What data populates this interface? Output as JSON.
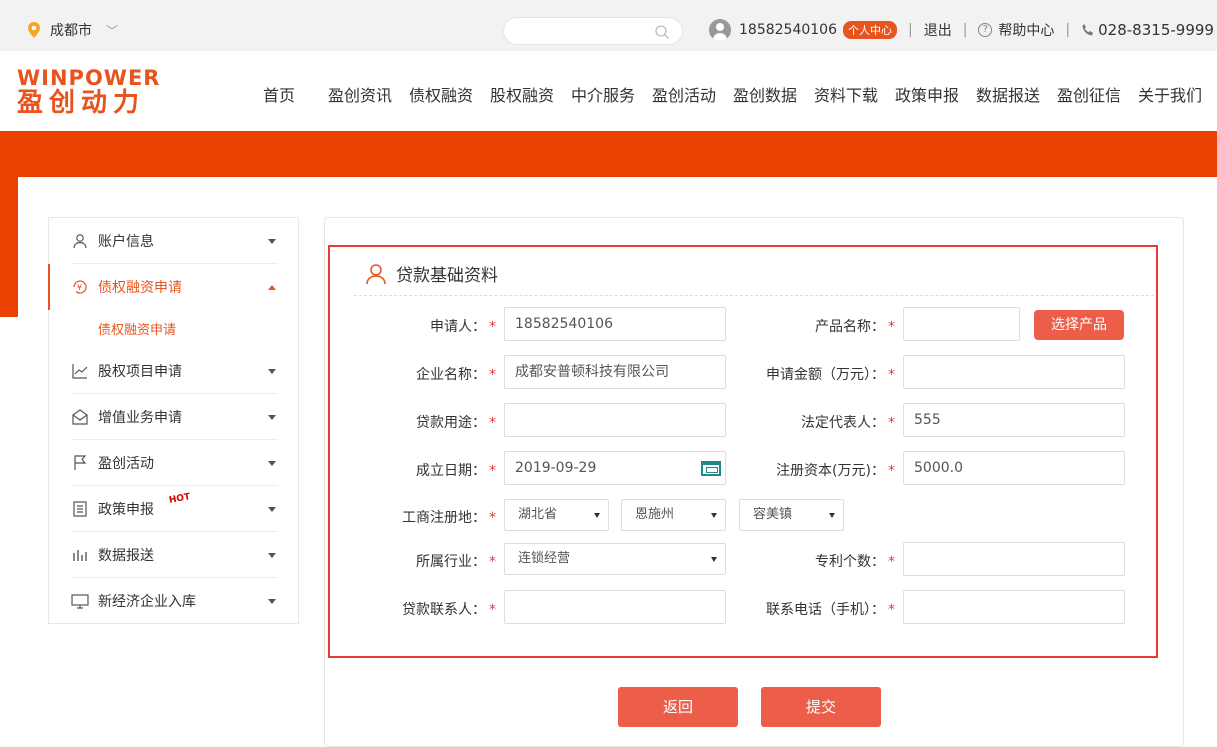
{
  "topbar": {
    "city": "成都市",
    "search_placeholder": "",
    "phone_user": "18582540106",
    "personal_center": "个人中心",
    "logout": "退出",
    "help": "帮助中心",
    "hotline": "028-8315-9999"
  },
  "logo": {
    "en": "WINPOWER",
    "cn": "盈创动力"
  },
  "nav": [
    "首页",
    "盈创资讯",
    "债权融资",
    "股权融资",
    "中介服务",
    "盈创活动",
    "盈创数据",
    "资料下载",
    "政策申报",
    "数据报送",
    "盈创征信",
    "关于我们"
  ],
  "sidebar": {
    "items": [
      {
        "label": "账户信息",
        "icon": "user-icon"
      },
      {
        "label": "债权融资申请",
        "icon": "yuan-cycle-icon"
      },
      {
        "label": "股权项目申请",
        "icon": "chart-line-icon"
      },
      {
        "label": "增值业务申请",
        "icon": "envelope-open-icon"
      },
      {
        "label": "盈创活动",
        "icon": "flag-icon"
      },
      {
        "label": "政策申报",
        "icon": "document-list-icon"
      },
      {
        "label": "数据报送",
        "icon": "bar-chart-icon"
      },
      {
        "label": "新经济企业入库",
        "icon": "computer-icon"
      }
    ],
    "sub_item": "债权融资申请",
    "hot": "HOT"
  },
  "form": {
    "title": "贷款基础资料",
    "labels": {
      "applicant": "申请人：",
      "product_name": "产品名称：",
      "company_name": "企业名称：",
      "apply_amount": "申请金额（万元）：",
      "loan_use": "贷款用途：",
      "legal_rep": "法定代表人：",
      "found_date": "成立日期：",
      "reg_capital": "注册资本(万元)：",
      "reg_place": "工商注册地：",
      "industry": "所属行业：",
      "patents": "专利个数：",
      "loan_contact": "贷款联系人：",
      "contact_phone": "联系电话（手机）："
    },
    "values": {
      "applicant": "18582540106",
      "product_name": "",
      "company_name": "成都安普顿科技有限公司",
      "apply_amount": "",
      "loan_use": "",
      "legal_rep": "555",
      "found_date": "2019-09-29",
      "reg_capital": "5000.0",
      "province": "湖北省",
      "city": "恩施州",
      "town": "容美镇",
      "industry": "连锁经营",
      "patents": "",
      "loan_contact": "",
      "contact_phone": ""
    },
    "required_mark": "*",
    "choose_product": "选择产品"
  },
  "actions": {
    "back": "返回",
    "submit": "提交"
  },
  "colors": {
    "accent": "#e84100",
    "button": "#ec5e4a",
    "highlight_border": "#e8393a"
  }
}
